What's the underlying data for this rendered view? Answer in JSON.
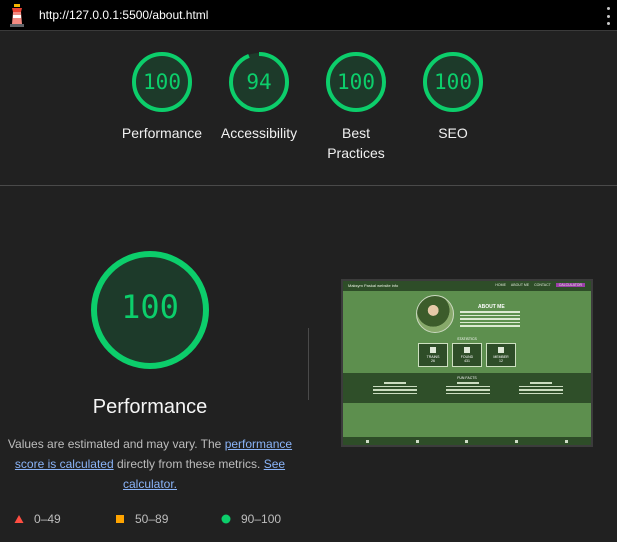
{
  "topbar": {
    "url": "http://127.0.0.1:5500/about.html"
  },
  "categories": [
    {
      "label": "Performance",
      "score": 100
    },
    {
      "label": "Accessibility",
      "score": 94
    },
    {
      "label": "Best Practices",
      "score": 100
    },
    {
      "label": "SEO",
      "score": 100
    }
  ],
  "summary": {
    "score": 100,
    "title": "Performance",
    "desc_start": "Values are estimated and may vary. The",
    "link_score": "performance score is calculated",
    "desc_middle": "directly from these metrics.",
    "link_calc": "See calculator."
  },
  "legend": [
    {
      "range": "0–49",
      "color": "#ff4e42",
      "shape": "triangle"
    },
    {
      "range": "50–89",
      "color": "#ffa400",
      "shape": "square"
    },
    {
      "range": "90–100",
      "color": "#0cce6b",
      "shape": "circle"
    }
  ],
  "colors": {
    "pass": "#0cce6b",
    "pass_bg": "#1d3a2a"
  },
  "preview": {
    "nav_title": "Maksym Paskal website info",
    "nav_links": [
      "HOME",
      "ABOUT ME",
      "CONTACT",
      "CALCULATOR"
    ],
    "about_heading": "ABOUT ME",
    "stats_heading": "STATISTICS",
    "stats": [
      {
        "label": "TRAINS",
        "value": "26"
      },
      {
        "label": "FOUND",
        "value": "431"
      },
      {
        "label": "MEMBER",
        "value": "12"
      }
    ],
    "facts_heading": "FUN FACTS",
    "facts": [
      "MEMBERS 1",
      "MEMBERS 2",
      "MEMBERS 3"
    ]
  }
}
